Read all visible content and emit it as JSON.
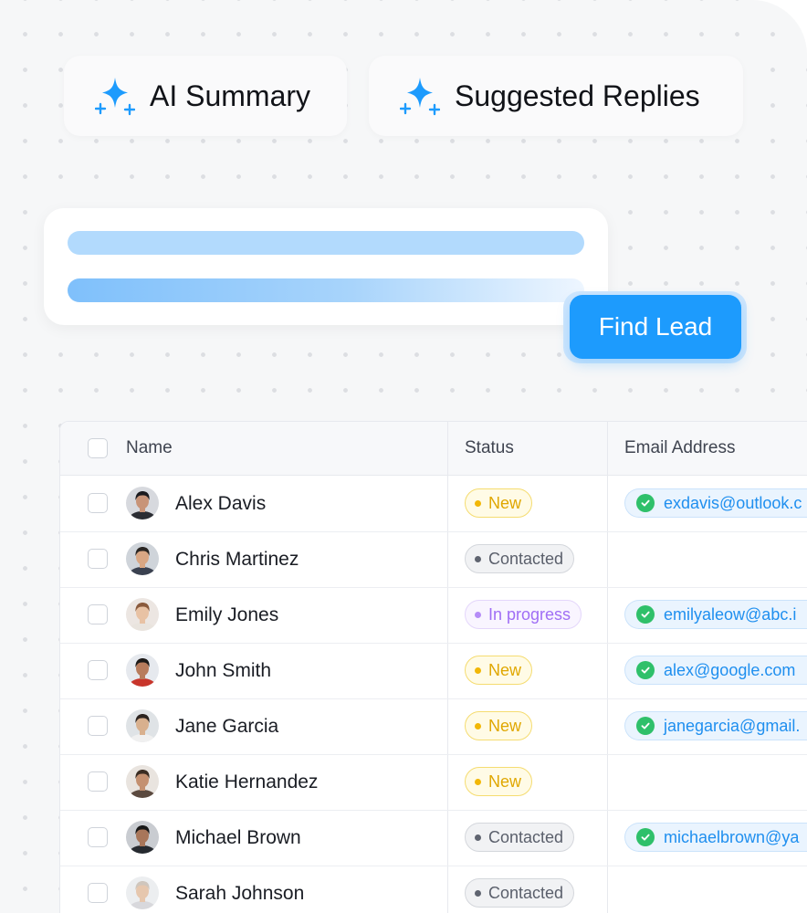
{
  "chips": [
    {
      "label": "AI Summary",
      "icon": "sparkle-icon"
    },
    {
      "label": "Suggested Replies",
      "icon": "sparkle-icon"
    }
  ],
  "find_lead_label": "Find Lead",
  "colors": {
    "accent": "#1d9bfd",
    "new_badge_bg": "#fffbe6",
    "new_badge_border": "#f5dc70",
    "new_badge_text": "#e0a700",
    "contacted_bg": "#f1f2f4",
    "contacted_text": "#5a5f6b",
    "in_progress_text": "#a06ef5",
    "verified_check": "#2fc06a"
  },
  "table": {
    "columns": [
      "Name",
      "Status",
      "Email Address"
    ],
    "rows": [
      {
        "name": "Alex Davis",
        "status": "New",
        "email": "exdavis@outlook.c"
      },
      {
        "name": "Chris Martinez",
        "status": "Contacted",
        "email": ""
      },
      {
        "name": "Emily Jones",
        "status": "In progress",
        "email": "emilyaleow@abc.i"
      },
      {
        "name": "John Smith",
        "status": "New",
        "email": "alex@google.com"
      },
      {
        "name": "Jane Garcia",
        "status": "New",
        "email": "janegarcia@gmail."
      },
      {
        "name": "Katie Hernandez",
        "status": "New",
        "email": ""
      },
      {
        "name": "Michael Brown",
        "status": "Contacted",
        "email": "michaelbrown@ya"
      },
      {
        "name": "Sarah Johnson",
        "status": "Contacted",
        "email": ""
      }
    ]
  }
}
